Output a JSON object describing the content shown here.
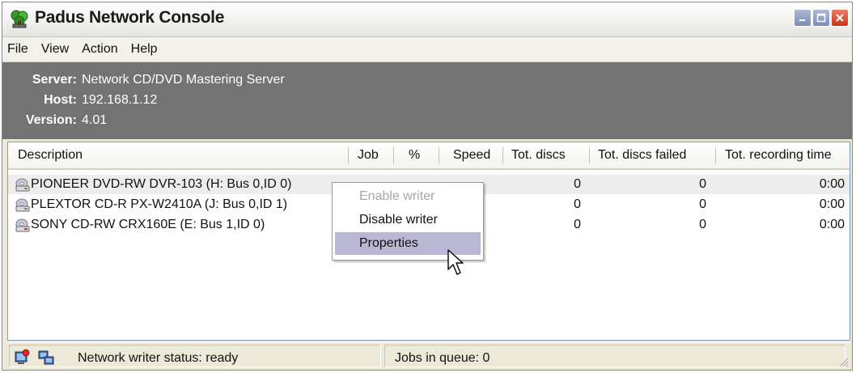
{
  "window": {
    "title": "Padus Network Console",
    "icon": "network-tree-icon",
    "controls": [
      "minimize-icon",
      "maximize-icon",
      "close-icon"
    ]
  },
  "menu": [
    "File",
    "View",
    "Action",
    "Help"
  ],
  "info": {
    "server_label": "Server:",
    "server_value": "Network CD/DVD Mastering Server",
    "host_label": "Host:",
    "host_value": "192.168.1.12",
    "version_label": "Version:",
    "version_value": "4.01"
  },
  "table": {
    "columns": [
      "Description",
      "Job",
      "%",
      "Speed",
      "Tot. discs",
      "Tot. discs failed",
      "Tot. recording time"
    ],
    "rows": [
      {
        "description": "PIONEER DVD-RW  DVR-103 (H: Bus 0,ID 0)",
        "job": "",
        "percent": "",
        "speed": "",
        "tot_discs": "0",
        "tot_failed": "0",
        "tot_time": "0:00",
        "selected": true
      },
      {
        "description": "PLEXTOR CD-R   PX-W2410A (J: Bus 0,ID 1)",
        "job": "",
        "percent": "",
        "speed": "",
        "tot_discs": "0",
        "tot_failed": "0",
        "tot_time": "0:00",
        "selected": false
      },
      {
        "description": "SONY CD-RW  CRX160E (E: Bus 1,ID 0)",
        "job": "",
        "percent": "",
        "speed": "",
        "tot_discs": "0",
        "tot_failed": "0",
        "tot_time": "0:00",
        "selected": false
      }
    ],
    "row_icon": "cd-writer-icon"
  },
  "context_menu": {
    "items": [
      {
        "label": "Enable writer",
        "enabled": false
      },
      {
        "label": "Disable writer",
        "enabled": true
      },
      {
        "label": "Properties",
        "enabled": true,
        "hovered": true
      }
    ]
  },
  "status": {
    "writer_status": "Network writer status: ready",
    "jobs_in_queue": "Jobs in queue: 0",
    "icons": [
      "alert-icon",
      "network-icon"
    ]
  },
  "colors": {
    "info_background": "#737373",
    "menu_hover": "#b9b7d4",
    "close_button": "#c8341a",
    "window_button": "#7c8bb8"
  }
}
